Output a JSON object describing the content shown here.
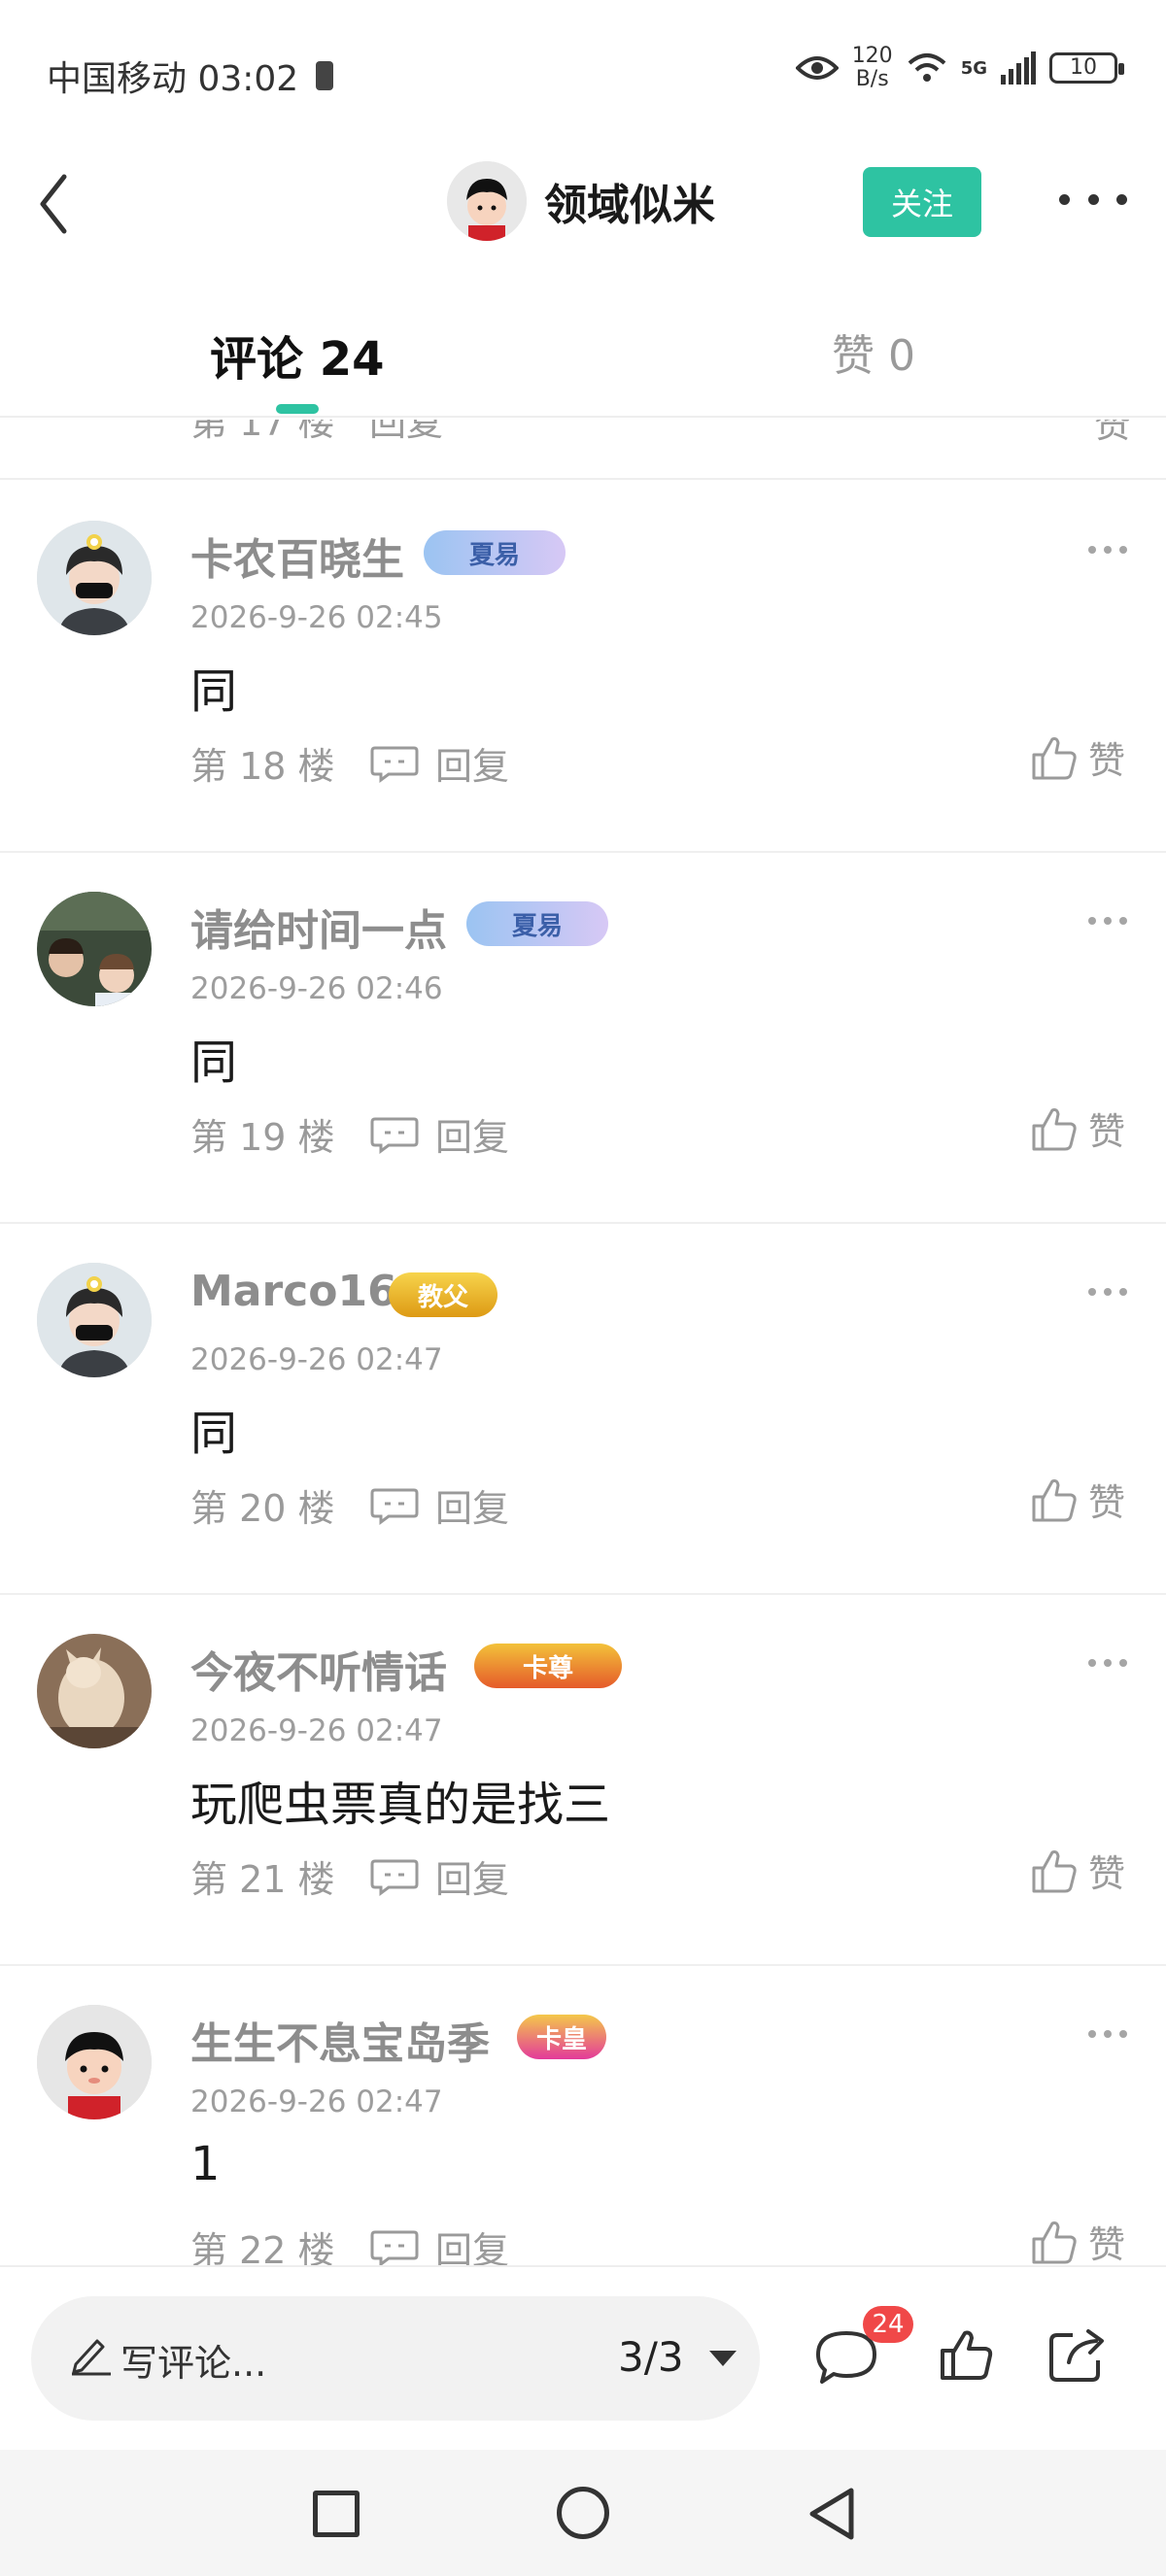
{
  "status_bar": {
    "carrier_time": "中国移动 03:02",
    "speed_value": "120",
    "speed_unit": "B/s",
    "network": "5G",
    "battery": "10"
  },
  "header": {
    "author_name": "领域似米",
    "follow_label": "关注"
  },
  "tabs": {
    "comments_label": "评论 24",
    "likes_label": "赞 0"
  },
  "partial_row": {
    "floor": "第 17 楼",
    "reply": "回复",
    "like": "赞"
  },
  "comments": [
    {
      "name": "卡农百晓生",
      "badge": "夏易",
      "badge_color": "#a9c9f2",
      "time": "2026-9-26 02:45",
      "text": "同",
      "floor": "第 18 楼",
      "reply": "回复",
      "like": "赞"
    },
    {
      "name": "请给时间一点",
      "badge": "夏易",
      "badge_color": "#a9c9f2",
      "time": "2026-9-26 02:46",
      "text": "同",
      "floor": "第 19 楼",
      "reply": "回复",
      "like": "赞"
    },
    {
      "name": "Marco16",
      "badge": "教父",
      "badge_color": "#e9b423",
      "time": "2026-9-26 02:47",
      "text": "同",
      "floor": "第 20 楼",
      "reply": "回复",
      "like": "赞"
    },
    {
      "name": "今夜不听情话",
      "badge": "卡尊",
      "badge_color": "#e55a2a",
      "time": "2026-9-26 02:47",
      "text": "玩爬虫票真的是找三",
      "floor": "第 21 楼",
      "reply": "回复",
      "like": "赞"
    },
    {
      "name": "生生不息宝岛季",
      "badge": "卡皇",
      "badge_color": "#e33a9a",
      "time": "2026-9-26 02:47",
      "text": "1",
      "floor": "第 22 楼",
      "reply": "回复",
      "like": "赞"
    }
  ],
  "bottom_bar": {
    "write_placeholder": "写评论...",
    "page_indicator": "3/3",
    "comment_count": "24"
  },
  "colors": {
    "accent": "#2ec3a2",
    "badge_red": "#f04848"
  }
}
